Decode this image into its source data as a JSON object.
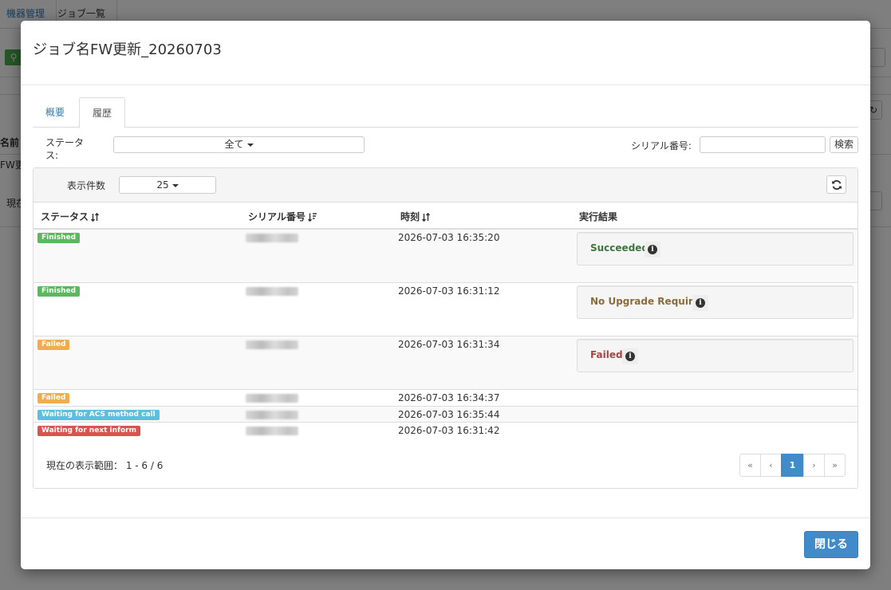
{
  "background": {
    "nav_tabs": [
      "機器管理",
      "ジョブ一覧"
    ],
    "label_name": "名前",
    "label_row": "FW更",
    "label_current": "現在"
  },
  "modal": {
    "title": "ジョブ名FW更新_20260703",
    "tabs": [
      {
        "label": "概要",
        "active": false
      },
      {
        "label": "履歴",
        "active": true
      }
    ],
    "filter": {
      "status_label": "ステータス:",
      "status_selected": "全て",
      "serial_label": "シリアル番号:",
      "serial_value": "",
      "search_button": "検索"
    },
    "panel": {
      "page_size_label": "表示件数",
      "page_size_value": "25",
      "refresh_icon": "refresh-icon"
    },
    "table": {
      "columns": [
        "ステータス",
        "シリアル番号",
        "時刻",
        "実行結果"
      ],
      "rows": [
        {
          "status": "Finished",
          "status_color": "#5cb85c",
          "time": "2026-07-03 16:35:20",
          "result": "Succeeded",
          "result_color": "#3c763d"
        },
        {
          "status": "Finished",
          "status_color": "#5cb85c",
          "time": "2026-07-03 16:31:12",
          "result": "No Upgrade Required",
          "result_color": "#8a6d3b"
        },
        {
          "status": "Failed",
          "status_color": "#f0ad4e",
          "time": "2026-07-03 16:31:34",
          "result": "Failed",
          "result_color": "#a94442"
        },
        {
          "status": "Failed",
          "status_color": "#f0ad4e",
          "time": "2026-07-03 16:34:37",
          "result": ""
        },
        {
          "status": "Waiting for ACS method call",
          "status_color": "#5bc0de",
          "time": "2026-07-03 16:35:44",
          "result": ""
        },
        {
          "status": "Waiting for next inform",
          "status_color": "#d9534f",
          "time": "2026-07-03 16:31:42",
          "result": ""
        }
      ]
    },
    "pagination": {
      "range_text": "現在の表示範囲： 1 - 6 / 6",
      "first": "«",
      "prev": "‹",
      "current": "1",
      "next": "›",
      "last": "»"
    },
    "close_button": "閉じる"
  }
}
